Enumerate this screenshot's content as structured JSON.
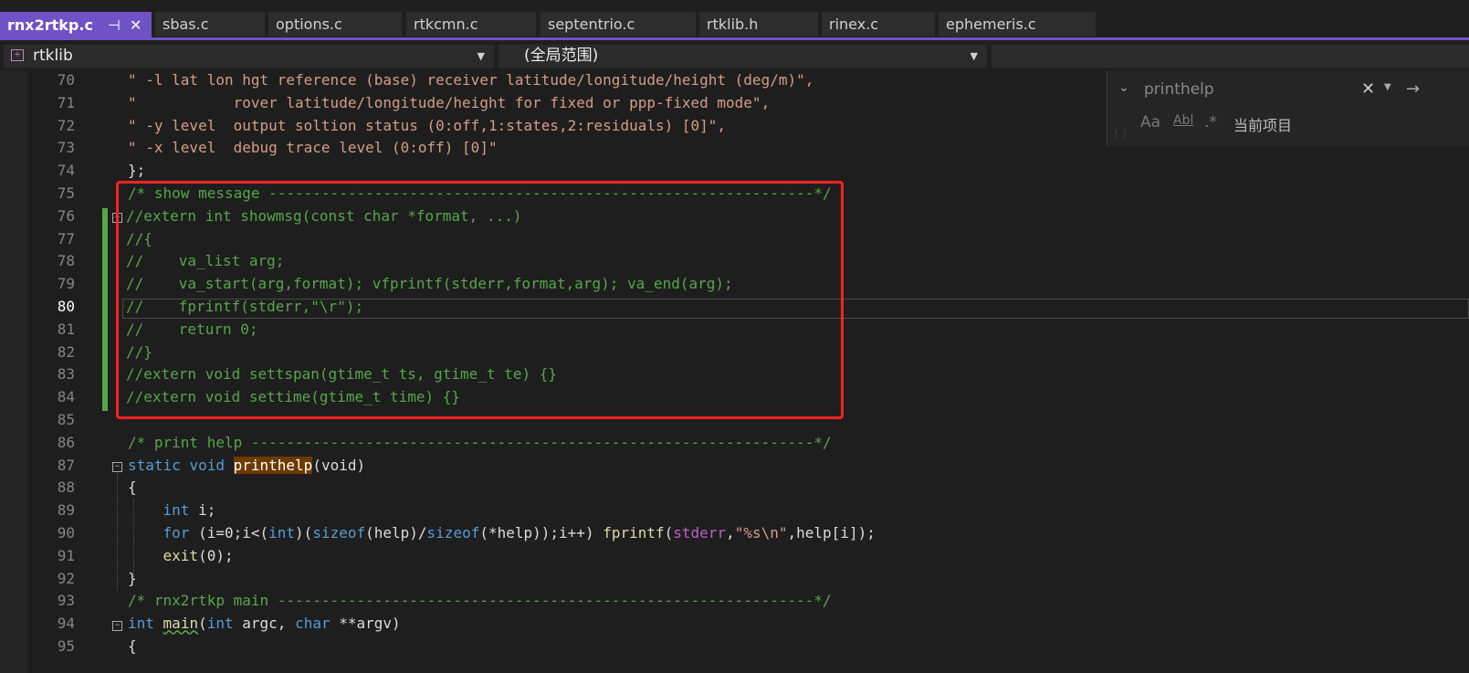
{
  "tabs": [
    {
      "label": "rnx2rtkp.c",
      "active": true
    },
    {
      "label": "sbas.c"
    },
    {
      "label": "options.c"
    },
    {
      "label": "rtkcmn.c"
    },
    {
      "label": "septentrio.c"
    },
    {
      "label": "rtklib.h"
    },
    {
      "label": "rinex.c"
    },
    {
      "label": "ephemeris.c"
    }
  ],
  "navbar": {
    "project": "rtklib",
    "scope": "(全局范围)"
  },
  "find": {
    "query": "printhelp",
    "scope": "当前项目",
    "match_case": "Aa",
    "whole_word": "Abl",
    "regex": ".*"
  },
  "lines": [
    {
      "n": "70",
      "text": "\" -l lat lon hgt reference (base) receiver latitude/longitude/height (deg/m)\","
    },
    {
      "n": "71",
      "text": "\"           rover latitude/longitude/height for fixed or ppp-fixed mode\","
    },
    {
      "n": "72",
      "text": "\" -y level  output soltion status (0:off,1:states,2:residuals) [0]\","
    },
    {
      "n": "73",
      "text": "\" -x level  debug trace level (0:off) [0]\""
    },
    {
      "n": "74",
      "text": "};"
    },
    {
      "n": "75",
      "text": "/* show message --------------------------------------------------------------*/"
    },
    {
      "n": "76",
      "text": "//extern int showmsg(const char *format, ...)"
    },
    {
      "n": "77",
      "text": "//{"
    },
    {
      "n": "78",
      "text": "//    va_list arg;"
    },
    {
      "n": "79",
      "text": "//    va_start(arg,format); vfprintf(stderr,format,arg); va_end(arg);"
    },
    {
      "n": "80",
      "text": "//    fprintf(stderr,\"\\r\");"
    },
    {
      "n": "81",
      "text": "//    return 0;"
    },
    {
      "n": "82",
      "text": "//}"
    },
    {
      "n": "83",
      "text": "//extern void settspan(gtime_t ts, gtime_t te) {}"
    },
    {
      "n": "84",
      "text": "//extern void settime(gtime_t time) {}"
    },
    {
      "n": "85",
      "text": ""
    },
    {
      "n": "86",
      "text": "/* print help ----------------------------------------------------------------*/"
    },
    {
      "n": "87",
      "text": ""
    },
    {
      "n": "88",
      "text": "{"
    },
    {
      "n": "89",
      "text": ""
    },
    {
      "n": "90",
      "text": ""
    },
    {
      "n": "91",
      "text": ""
    },
    {
      "n": "92",
      "text": "}"
    },
    {
      "n": "93",
      "text": "/* rnx2rtkp main -------------------------------------------------------------*/"
    },
    {
      "n": "94",
      "text": ""
    },
    {
      "n": "95",
      "text": "{"
    }
  ],
  "code87": {
    "kw1": "static",
    "kw2": "void",
    "fn": "printhelp",
    "rest": "(void)"
  },
  "code89": {
    "kw": "int",
    "rest": " i;"
  },
  "code90": {
    "kw_for": "for",
    "p1": " (i=0;i<(",
    "kw_int": "int",
    "p2": ")(",
    "kw_sz1": "sizeof",
    "p3": "(help)/",
    "kw_sz2": "sizeof",
    "p4": "(*help));i++) ",
    "fn": "fprintf",
    "p5": "(",
    "p5b": "stderr",
    "p5c": ",",
    "str": "\"%s\\n\"",
    "p6": ",help[i]);"
  },
  "code91": {
    "fn": "exit",
    "rest": "(0);"
  },
  "code94": {
    "kw1": "int",
    "fn": "main",
    "p1": "(",
    "kw2": "int",
    "p2": " argc, ",
    "kw3": "char",
    "p3": " **argv)"
  }
}
